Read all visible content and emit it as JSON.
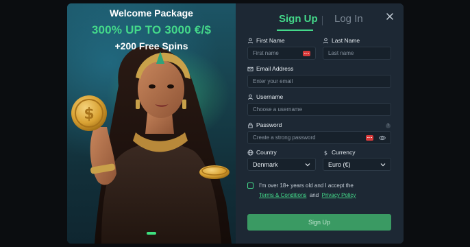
{
  "promo": {
    "title": "Welcome Package",
    "amount": "300% UP TO 3000 €/$",
    "spins": "+200 Free Spins"
  },
  "tabs": {
    "signup": "Sign Up",
    "login": "Log In"
  },
  "form": {
    "first_name": {
      "label": "First Name",
      "placeholder": "First name"
    },
    "last_name": {
      "label": "Last Name",
      "placeholder": "Last name"
    },
    "email": {
      "label": "Email Address",
      "placeholder": "Enter your email"
    },
    "username": {
      "label": "Username",
      "placeholder": "Choose a username"
    },
    "password": {
      "label": "Password",
      "placeholder": "Create a strong password",
      "help": "?"
    },
    "country": {
      "label": "Country",
      "value": "Denmark"
    },
    "currency": {
      "label": "Currency",
      "value": "Euro (€)"
    },
    "terms": {
      "line1": "I'm over 18+ years old and I accept the",
      "terms_link": "Terms & Conditions",
      "and": "and",
      "privacy_link": "Privacy Policy"
    },
    "submit_label": "Sign Up"
  },
  "colors": {
    "accent": "#44d98a",
    "panel": "#1d2834",
    "field": "#17212b",
    "badge": "#d63a3a"
  },
  "icons": [
    "close-icon",
    "user-icon",
    "mail-icon",
    "lock-icon",
    "globe-icon",
    "dollar-icon",
    "chevron-down-icon",
    "eye-icon"
  ]
}
